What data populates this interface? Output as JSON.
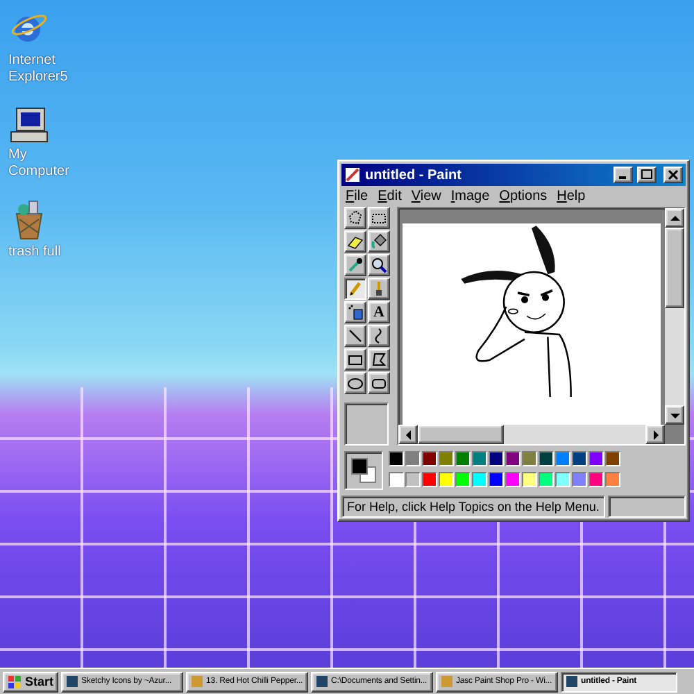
{
  "desktop_icons": [
    {
      "kind": "browser",
      "label": "Internet Explorer5"
    },
    {
      "kind": "computer",
      "label": "My Computer"
    },
    {
      "kind": "trash",
      "label": "trash full"
    }
  ],
  "window": {
    "title": "untitled - Paint",
    "menu": [
      {
        "label": "File"
      },
      {
        "label": "Edit"
      },
      {
        "label": "View"
      },
      {
        "label": "Image"
      },
      {
        "label": "Options"
      },
      {
        "label": "Help"
      }
    ],
    "tools": [
      {
        "kind": "free-select",
        "selected": false
      },
      {
        "kind": "select",
        "selected": false
      },
      {
        "kind": "eraser",
        "selected": false
      },
      {
        "kind": "fill",
        "selected": false
      },
      {
        "kind": "picker",
        "selected": false
      },
      {
        "kind": "magnifier",
        "selected": false
      },
      {
        "kind": "pencil",
        "selected": true
      },
      {
        "kind": "brush",
        "selected": false
      },
      {
        "kind": "airbrush",
        "selected": false
      },
      {
        "kind": "text",
        "glyph": "A",
        "selected": false
      },
      {
        "kind": "line",
        "selected": false
      },
      {
        "kind": "curve",
        "selected": false
      },
      {
        "kind": "rectangle",
        "selected": false
      },
      {
        "kind": "polygon",
        "selected": false
      },
      {
        "kind": "ellipse",
        "selected": false
      },
      {
        "kind": "rounded-rectangle",
        "selected": false
      }
    ],
    "palette": [
      {
        "color": "#000000"
      },
      {
        "color": "#808080"
      },
      {
        "color": "#800000"
      },
      {
        "color": "#808000"
      },
      {
        "color": "#008000"
      },
      {
        "color": "#008080"
      },
      {
        "color": "#000080"
      },
      {
        "color": "#800080"
      },
      {
        "color": "#808040"
      },
      {
        "color": "#004040"
      },
      {
        "color": "#0080ff"
      },
      {
        "color": "#004080"
      },
      {
        "color": "#8000ff"
      },
      {
        "color": "#804000"
      },
      {
        "color": "#ffffff"
      },
      {
        "color": "#c0c0c0"
      },
      {
        "color": "#ff0000"
      },
      {
        "color": "#ffff00"
      },
      {
        "color": "#00ff00"
      },
      {
        "color": "#00ffff"
      },
      {
        "color": "#0000ff"
      },
      {
        "color": "#ff00ff"
      },
      {
        "color": "#ffff80"
      },
      {
        "color": "#00ff80"
      },
      {
        "color": "#80ffff"
      },
      {
        "color": "#8080ff"
      },
      {
        "color": "#ff0080"
      },
      {
        "color": "#ff8040"
      }
    ],
    "status": "For Help, click Help Topics on the Help Menu."
  },
  "taskbar": {
    "start": "Start",
    "buttons": [
      {
        "label": "Sketchy Icons by ~Azur...",
        "selected": false
      },
      {
        "label": "13. Red Hot Chilli Pepper...",
        "selected": false
      },
      {
        "label": "C:\\Documents and Settin...",
        "selected": false
      },
      {
        "label": "Jasc Paint Shop Pro - Wi...",
        "selected": false
      },
      {
        "label": "untitled - Paint",
        "selected": true
      }
    ]
  }
}
